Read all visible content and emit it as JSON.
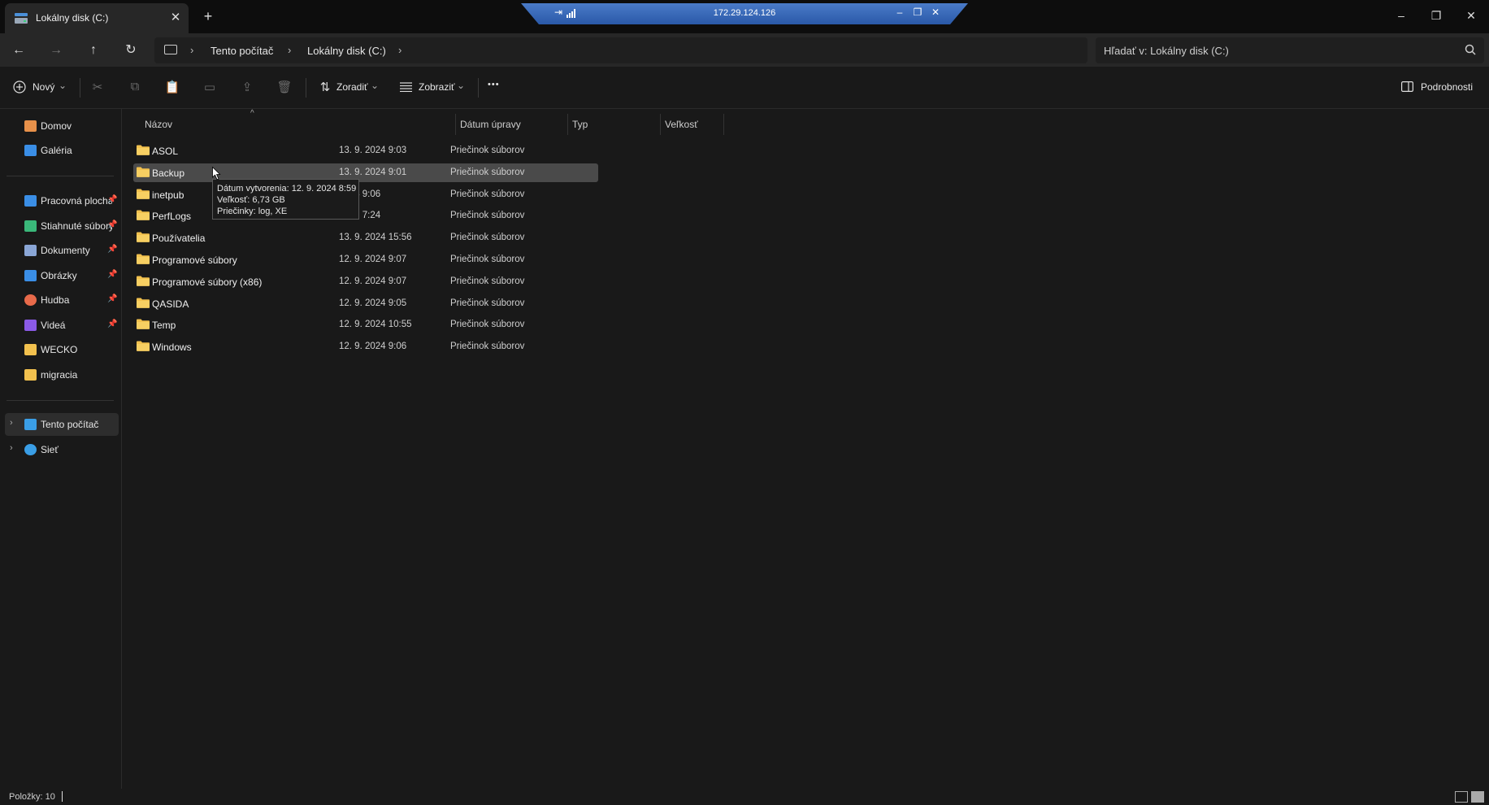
{
  "window": {
    "tab_title": "Lokálny disk (C:)",
    "tab_close": "✕",
    "new_tab": "+",
    "minimize": "–",
    "maximize": "❐",
    "close": "✕"
  },
  "rdp": {
    "host": "172.29.124.126",
    "pin": "⇥",
    "minimize": "–",
    "restore": "❐",
    "close": "✕"
  },
  "nav": {
    "back": "←",
    "forward": "→",
    "up": "↑",
    "refresh": "↻",
    "breadcrumb": [
      "Tento počítač",
      "Lokálny disk (C:)"
    ],
    "chevron": "›",
    "search_placeholder": "Hľadať v: Lokálny disk (C:)"
  },
  "toolbar": {
    "new_label": "Nový",
    "sort_label": "Zoradiť",
    "view_label": "Zobraziť",
    "more": "•••",
    "details_label": "Podrobnosti",
    "dropdown": "⌄"
  },
  "sidebar": {
    "quick": [
      {
        "label": "Domov",
        "icon": "home-icon",
        "color": "#e8914a"
      },
      {
        "label": "Galéria",
        "icon": "gallery-icon",
        "color": "#3a8ee6"
      }
    ],
    "pinned": [
      {
        "label": "Pracovná plocha",
        "icon": "desktop-icon",
        "color": "#3a8ee6",
        "pin": "📌"
      },
      {
        "label": "Stiahnuté súbory",
        "icon": "download-icon",
        "color": "#3ab87a",
        "pin": "📌"
      },
      {
        "label": "Dokumenty",
        "icon": "documents-icon",
        "color": "#8aa6d6",
        "pin": "📌"
      },
      {
        "label": "Obrázky",
        "icon": "pictures-icon",
        "color": "#3a8ee6",
        "pin": "📌"
      },
      {
        "label": "Hudba",
        "icon": "music-icon",
        "color": "#e86a4a",
        "pin": "📌"
      },
      {
        "label": "Videá",
        "icon": "videos-icon",
        "color": "#8a5ae6",
        "pin": "📌"
      },
      {
        "label": "WECKO",
        "icon": "folder-icon",
        "color": "#f2c14e",
        "pin": ""
      },
      {
        "label": "migracia",
        "icon": "folder-icon",
        "color": "#f2c14e",
        "pin": ""
      }
    ],
    "devices": [
      {
        "label": "Tento počítač",
        "icon": "computer-icon",
        "color": "#3a9ee6"
      },
      {
        "label": "Sieť",
        "icon": "network-icon",
        "color": "#3a9ee6"
      }
    ],
    "expand": "›"
  },
  "columns": {
    "name": "Názov",
    "date": "Dátum úpravy",
    "type": "Typ",
    "size": "Veľkosť",
    "sort_caret": "^"
  },
  "files": [
    {
      "name": "ASOL",
      "date": "13. 9. 2024 9:03",
      "type": "Priečinok súborov"
    },
    {
      "name": "Backup",
      "date": "13. 9. 2024 9:01",
      "type": "Priečinok súborov"
    },
    {
      "name": "inetpub",
      "date": "2024 9:06",
      "type": "Priečinok súborov"
    },
    {
      "name": "PerfLogs",
      "date": "2022 7:24",
      "type": "Priečinok súborov"
    },
    {
      "name": "Používatelia",
      "date": "13. 9. 2024 15:56",
      "type": "Priečinok súborov"
    },
    {
      "name": "Programové súbory",
      "date": "12. 9. 2024 9:07",
      "type": "Priečinok súborov"
    },
    {
      "name": "Programové súbory (x86)",
      "date": "12. 9. 2024 9:07",
      "type": "Priečinok súborov"
    },
    {
      "name": "QASIDA",
      "date": "12. 9. 2024 9:05",
      "type": "Priečinok súborov"
    },
    {
      "name": "Temp",
      "date": "12. 9. 2024 10:55",
      "type": "Priečinok súborov"
    },
    {
      "name": "Windows",
      "date": "12. 9. 2024 9:06",
      "type": "Priečinok súborov"
    }
  ],
  "tooltip": {
    "line1": "Dátum vytvorenia: 12. 9. 2024 8:59",
    "line2": "Veľkosť: 6,73 GB",
    "line3": "Priečinky: log, XE"
  },
  "status": {
    "items": "Položky: 10"
  },
  "colors": {
    "folder": "#f2c14e",
    "selected_row": "#4a4a4a",
    "rdp_bar": "#3a6ab8"
  }
}
